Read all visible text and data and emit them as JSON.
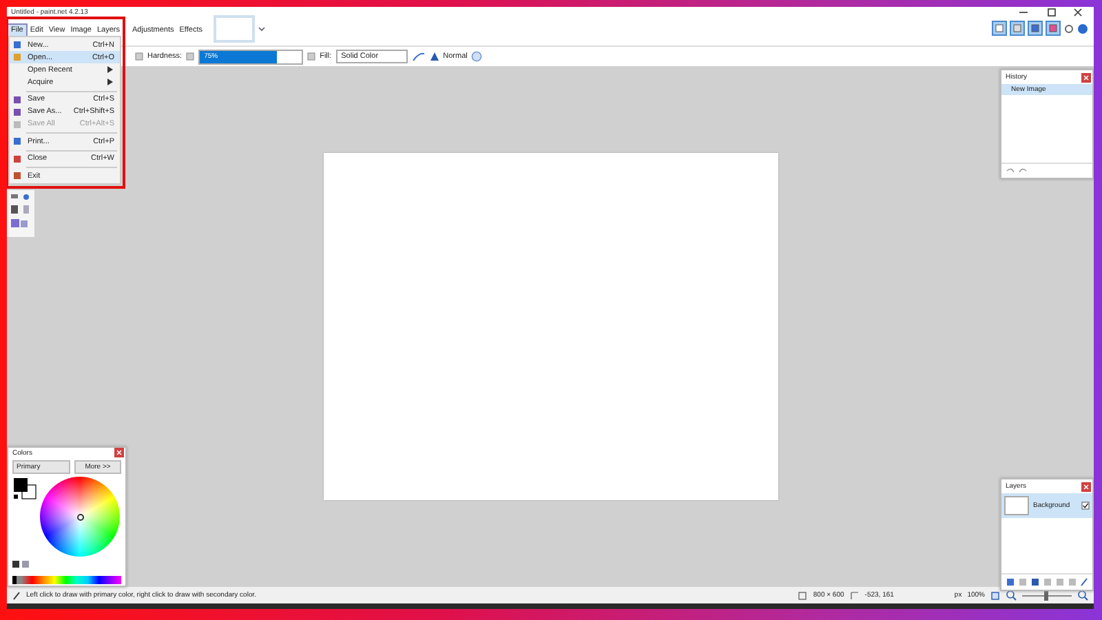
{
  "window": {
    "title": "Untitled - paint.net 4.2.13"
  },
  "menu": [
    {
      "label": "File",
      "selected": true
    },
    {
      "label": "Edit",
      "selected": false
    },
    {
      "label": "View",
      "selected": false
    },
    {
      "label": "Image",
      "selected": false
    },
    {
      "label": "Layers",
      "selected": false
    },
    {
      "label": "Adjustments",
      "selected": false
    },
    {
      "label": "Effects",
      "selected": false
    }
  ],
  "panel_toggles": [
    {
      "on": true
    },
    {
      "on": true
    },
    {
      "on": true
    },
    {
      "on": true
    }
  ],
  "file_menu": [
    {
      "kind": "item",
      "label": "New...",
      "shortcut": "Ctrl+N",
      "selected": false,
      "disabled": false
    },
    {
      "kind": "item",
      "label": "Open...",
      "shortcut": "Ctrl+O",
      "selected": true,
      "disabled": false
    },
    {
      "kind": "submenu",
      "label": "Open Recent",
      "selected": false,
      "disabled": false
    },
    {
      "kind": "submenu",
      "label": "Acquire",
      "selected": false,
      "disabled": false
    },
    {
      "kind": "separator"
    },
    {
      "kind": "item",
      "label": "Save",
      "shortcut": "Ctrl+S",
      "selected": false,
      "disabled": false
    },
    {
      "kind": "item",
      "label": "Save As...",
      "shortcut": "Ctrl+Shift+S",
      "selected": false,
      "disabled": false
    },
    {
      "kind": "item",
      "label": "Save All",
      "shortcut": "Ctrl+Alt+S",
      "selected": false,
      "disabled": true
    },
    {
      "kind": "separator"
    },
    {
      "kind": "item",
      "label": "Print...",
      "shortcut": "Ctrl+P",
      "selected": false,
      "disabled": false
    },
    {
      "kind": "separator"
    },
    {
      "kind": "item",
      "label": "Close",
      "shortcut": "Ctrl+W",
      "selected": false,
      "disabled": false
    },
    {
      "kind": "separator"
    },
    {
      "kind": "item",
      "label": "Exit",
      "selected": false,
      "disabled": false
    }
  ],
  "toolbar": {
    "hardness_label": "Hardness:",
    "hardness_value": "75%",
    "level": 0.75,
    "fill_label": "Fill:",
    "fill_value": "Solid Color",
    "blend_mode": "Normal"
  },
  "history": {
    "title": "History",
    "items": [
      {
        "label": "New Image",
        "selected": true
      }
    ]
  },
  "colors": {
    "title": "Colors",
    "mode": "Primary",
    "more_button": "More >>"
  },
  "layers": {
    "title": "Layers",
    "items": [
      {
        "name": "Background",
        "selected": true,
        "visible": true
      }
    ]
  },
  "status_bar": {
    "hint": "Left click to draw with primary color, right click to draw with secondary color.",
    "image_size": "800 × 600",
    "cursor_position": "-523, 161",
    "units": "px",
    "zoom": "100%",
    "zoom_slider": {
      "level": 0.45
    }
  }
}
